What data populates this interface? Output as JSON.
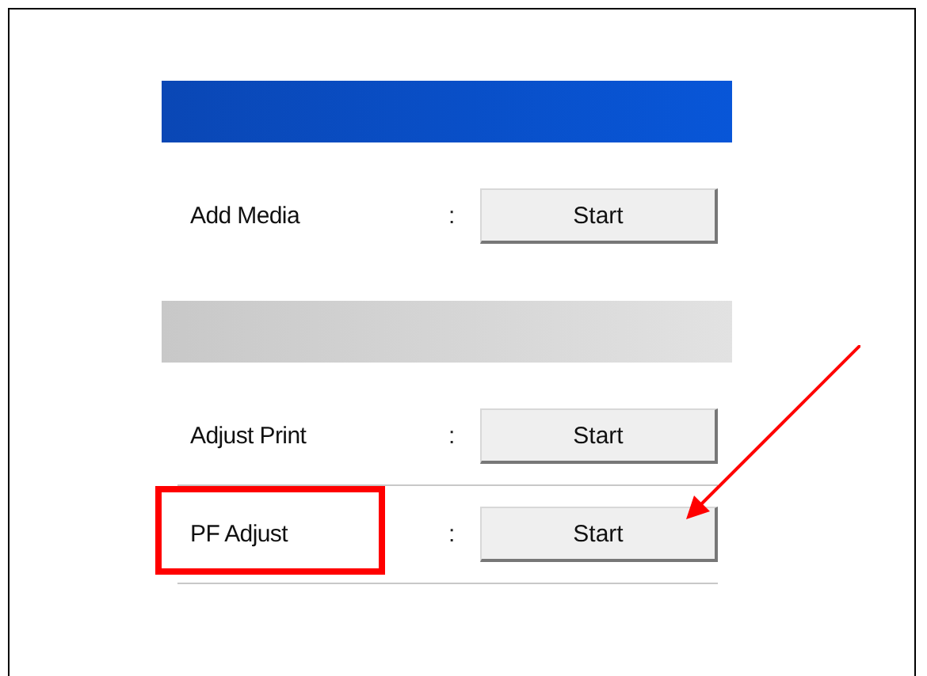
{
  "sections": [
    {
      "kind": "primary",
      "rows": [
        {
          "label": "Add Media",
          "separator": ":",
          "button": "Start",
          "highlighted": false
        }
      ]
    },
    {
      "kind": "secondary",
      "rows": [
        {
          "label": "Adjust Print",
          "separator": ":",
          "button": "Start",
          "highlighted": false
        },
        {
          "label": "PF Adjust",
          "separator": ":",
          "button": "Start",
          "highlighted": true
        }
      ]
    }
  ]
}
